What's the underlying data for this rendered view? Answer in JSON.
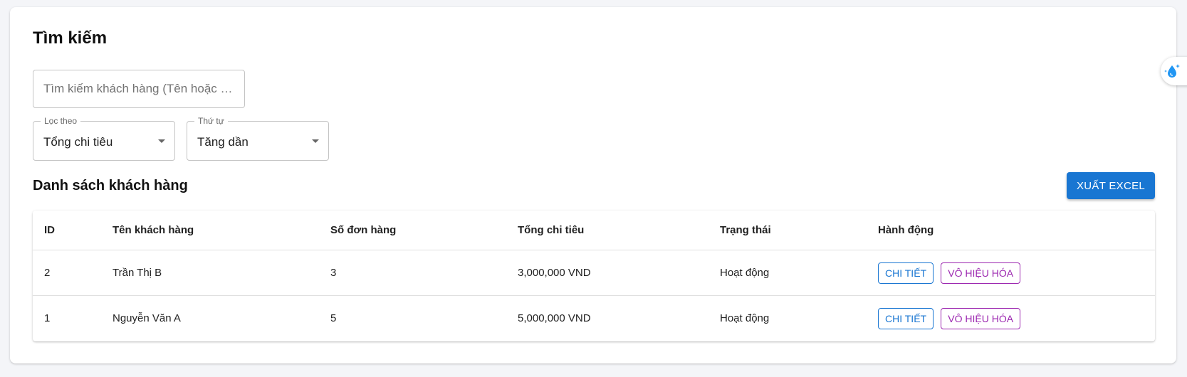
{
  "search": {
    "title": "Tìm kiếm",
    "placeholder": "Tìm kiếm khách hàng (Tên hoặc Số điện thoại)",
    "value": ""
  },
  "filters": {
    "filter_by": {
      "label": "Lọc theo",
      "value": "Tổng chi tiêu"
    },
    "order": {
      "label": "Thứ tự",
      "value": "Tăng dần"
    }
  },
  "list": {
    "title": "Danh sách khách hàng",
    "export_label": "XUẤT EXCEL"
  },
  "table": {
    "columns": [
      "ID",
      "Tên khách hàng",
      "Số đơn hàng",
      "Tổng chi tiêu",
      "Trạng thái",
      "Hành động"
    ],
    "rows": [
      {
        "id": "2",
        "name": "Trần Thị B",
        "orders": "3",
        "total": "3,000,000 VND",
        "status": "Hoạt động",
        "detail_label": "CHI TIẾT",
        "disable_label": "VÔ HIỆU HÓA"
      },
      {
        "id": "1",
        "name": "Nguyễn Văn A",
        "orders": "5",
        "total": "5,000,000 VND",
        "status": "Hoạt động",
        "detail_label": "CHI TIẾT",
        "disable_label": "VÔ HIỆU HÓA"
      }
    ]
  },
  "floating_widget": {
    "icon": "water-drop-sparkle-icon"
  },
  "colors": {
    "primary": "#1976d2",
    "secondary": "#9c27b0",
    "background": "#f4f5f8"
  }
}
